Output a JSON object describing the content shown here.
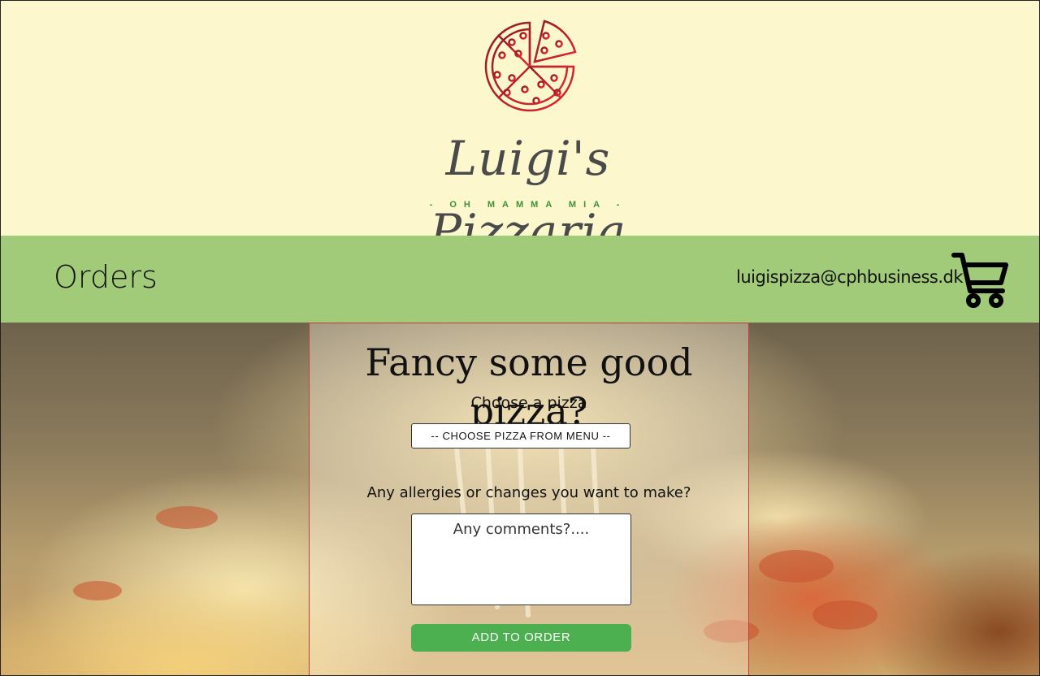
{
  "header": {
    "brand_name": "Luigi's Pizzaria",
    "tagline": "- OH MAMMA MIA -",
    "logo_icon": "pizza-icon",
    "logo_color": "#c0202a"
  },
  "navbar": {
    "orders_label": "Orders",
    "email": "luigispizza@cphbusiness.dk",
    "cart_icon": "shopping-cart-icon",
    "background": "#a1ca79"
  },
  "order_form": {
    "title": "Fancy some good pizza?",
    "choose_label": "Choose a pizza",
    "select_value": "-- CHOOSE PIZZA FROM MENU --",
    "allergy_label": "Any allergies or changes you want to make?",
    "comments_placeholder": "Any comments?....",
    "add_button_label": "ADD TO ORDER",
    "button_color": "#4caf50",
    "panel_border_color": "#c43c3c"
  }
}
